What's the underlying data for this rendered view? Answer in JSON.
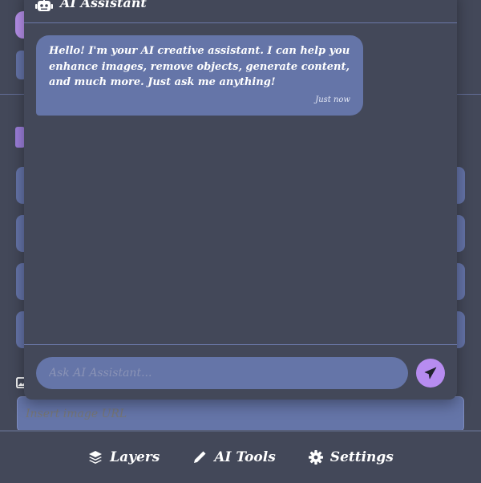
{
  "chat": {
    "title": "AI Assistant",
    "messages": [
      {
        "text": "Hello! I'm your AI creative assistant. I can help you enhance images, remove objects, generate content, and much more. Just ask me anything!",
        "time": "Just now"
      }
    ],
    "input_placeholder": "Ask AI Assistant...",
    "icons": {
      "header": "robot-icon",
      "send": "paper-plane-icon"
    }
  },
  "background": {
    "url_input_placeholder": "Insert image URL",
    "url_icon": "image-icon"
  },
  "bottom_nav": {
    "items": [
      {
        "label": "Layers",
        "icon": "layers-icon"
      },
      {
        "label": "AI Tools",
        "icon": "pencil-icon"
      },
      {
        "label": "Settings",
        "icon": "gear-icon"
      }
    ]
  },
  "colors": {
    "background": "#434859",
    "bubble": "#6575a8",
    "accent": "#b78cf0",
    "divider": "#6b78a8"
  }
}
